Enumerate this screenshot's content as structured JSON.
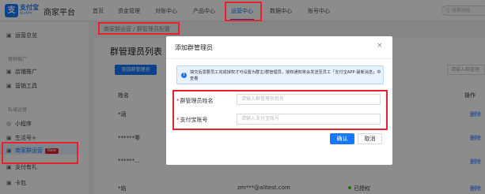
{
  "header": {
    "logo_glyph": "支",
    "logo_text": "支付宝",
    "logo_sub": "ALIPAY",
    "platform": "商家平台",
    "nav": [
      "首页",
      "资金管理",
      "对账中心",
      "产品中心",
      "运营中心",
      "数据中心",
      "账号中心"
    ],
    "active_nav": "运营中心",
    "search_placeholder": "Q 搜索功能"
  },
  "breadcrumb": {
    "parent": "商家群运营",
    "sep": "/",
    "current": "群管理员配置"
  },
  "sidebar": {
    "items": [
      {
        "icon": "▣",
        "label": "运营总览"
      },
      {
        "group": "营销推广"
      },
      {
        "icon": "▣",
        "label": "店铺推广"
      },
      {
        "icon": "▣",
        "label": "营销工具"
      },
      {
        "group": "私域运营"
      },
      {
        "icon": "◎",
        "label": "小程序"
      },
      {
        "icon": "▣",
        "label": "生活号+"
      },
      {
        "icon": "▣",
        "label": "商家群运营",
        "badge": "New"
      },
      {
        "icon": "▣",
        "label": "支付有礼"
      },
      {
        "icon": "▣",
        "label": "卡包"
      }
    ]
  },
  "main": {
    "title": "群管理员列表",
    "add_button": "添加群管理员",
    "search_placeholder": "请输入群管理",
    "columns": [
      "姓名",
      "操作"
    ],
    "rows": [
      {
        "name": "*涵",
        "action": "删除"
      },
      {
        "name": "******零",
        "action": "删除"
      },
      {
        "name": "******...",
        "action": "删除"
      },
      {
        "name": "*焰",
        "email": "zm***@alitest.com",
        "status": "已授权",
        "action": "删除"
      }
    ]
  },
  "modal": {
    "title": "添加群管理员",
    "close": "×",
    "notice_icon": "!",
    "notice": "填交后需要员工完成授权才可设置为群主/群管理员，授权通知将会发送至员工「支付宝APP-最新消息」中查看",
    "fields": [
      {
        "required": "*",
        "label": "群管理员姓名",
        "placeholder": "请输入群管理员姓名"
      },
      {
        "required": "*",
        "label": "支付宝账号",
        "placeholder": "请输入支付宝账号"
      }
    ],
    "ok": "确认",
    "cancel": "取消"
  },
  "colors": {
    "accent": "#1677ff",
    "highlight": "#e8212b"
  }
}
